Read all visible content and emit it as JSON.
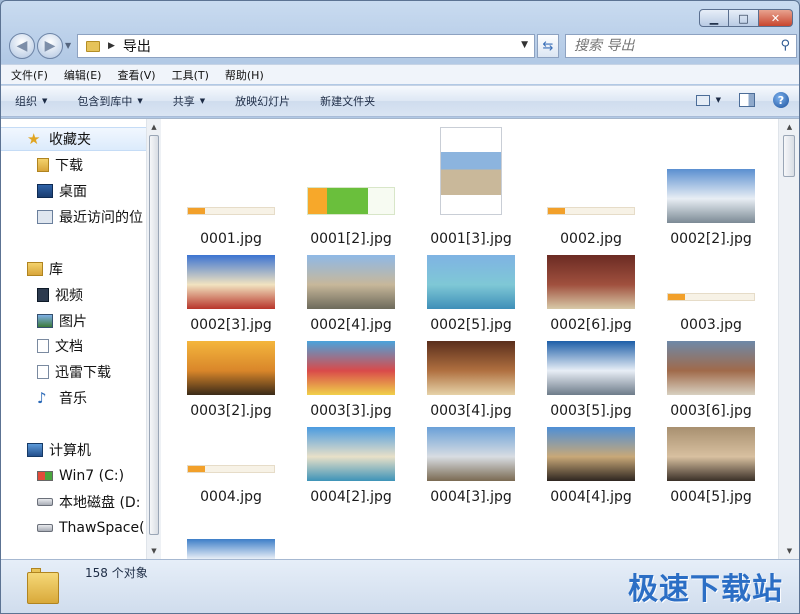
{
  "window": {
    "caption_buttons": {
      "minimize_icon": "minimize-icon",
      "maximize_icon": "maximize-icon",
      "close_icon": "close-icon"
    }
  },
  "address_bar": {
    "path": "导出",
    "search_placeholder": "搜索 导出"
  },
  "menu": [
    "文件(F)",
    "编辑(E)",
    "查看(V)",
    "工具(T)",
    "帮助(H)"
  ],
  "toolbar": {
    "organize": "组织",
    "include_in_library": "包含到库中",
    "share": "共享",
    "slideshow": "放映幻灯片",
    "new_folder": "新建文件夹"
  },
  "navigation": {
    "favorites_header": "收藏夹",
    "favorites": [
      "下载",
      "桌面",
      "最近访问的位"
    ],
    "libraries_header": "库",
    "libraries": [
      "视频",
      "图片",
      "文档",
      "迅雷下载",
      "音乐"
    ],
    "computer_header": "计算机",
    "drives": [
      "Win7 (C:)",
      "本地磁盘 (D:",
      "ThawSpace("
    ]
  },
  "files": [
    {
      "name": "0001.jpg",
      "kind": "banner"
    },
    {
      "name": "0001[2].jpg",
      "kind": "logo"
    },
    {
      "name": "0001[3].jpg",
      "kind": "cover"
    },
    {
      "name": "0002.jpg",
      "kind": "banner"
    },
    {
      "name": "0002[2].jpg",
      "kind": "photo",
      "colors": [
        "#5a8fd0",
        "#e8eef4",
        "#7c8a95"
      ]
    },
    {
      "name": "0002[3].jpg",
      "kind": "photo",
      "colors": [
        "#3c74d2",
        "#f1e3c0",
        "#b8352a"
      ]
    },
    {
      "name": "0002[4].jpg",
      "kind": "photo",
      "colors": [
        "#8fb9e6",
        "#c7b79a",
        "#6d6a5b"
      ]
    },
    {
      "name": "0002[5].jpg",
      "kind": "photo",
      "colors": [
        "#7fb3e3",
        "#7fc8d6",
        "#3e8fb8"
      ]
    },
    {
      "name": "0002[6].jpg",
      "kind": "photo",
      "colors": [
        "#6b2b23",
        "#a0503e",
        "#d8c9a8"
      ]
    },
    {
      "name": "0003.jpg",
      "kind": "banner"
    },
    {
      "name": "0003[2].jpg",
      "kind": "photo",
      "colors": [
        "#f4b63d",
        "#d9862a",
        "#3a2a18"
      ]
    },
    {
      "name": "0003[3].jpg",
      "kind": "photo",
      "colors": [
        "#4aa3dc",
        "#d94a4a",
        "#f0d04a"
      ]
    },
    {
      "name": "0003[4].jpg",
      "kind": "photo",
      "colors": [
        "#5a2e1c",
        "#b07040",
        "#e6d2a8"
      ]
    },
    {
      "name": "0003[5].jpg",
      "kind": "photo",
      "colors": [
        "#1d5ea8",
        "#e8eef6",
        "#6e7c8a"
      ]
    },
    {
      "name": "0003[6].jpg",
      "kind": "photo",
      "colors": [
        "#6e89a8",
        "#a06a4a",
        "#d8d0c0"
      ]
    },
    {
      "name": "0004.jpg",
      "kind": "banner"
    },
    {
      "name": "0004[2].jpg",
      "kind": "photo",
      "colors": [
        "#4a9be0",
        "#e8e0c8",
        "#3d93b8"
      ]
    },
    {
      "name": "0004[3].jpg",
      "kind": "photo",
      "colors": [
        "#6aa0d8",
        "#d8dde2",
        "#7a6a52"
      ]
    },
    {
      "name": "0004[4].jpg",
      "kind": "photo",
      "colors": [
        "#4e8fd6",
        "#c8a878",
        "#2e2620"
      ]
    },
    {
      "name": "0004[5].jpg",
      "kind": "photo",
      "colors": [
        "#a89070",
        "#d8c0a0",
        "#3a3028"
      ]
    },
    {
      "name": "",
      "kind": "partial",
      "colors": [
        "#3d7ec8",
        "#e8eef6",
        "#ffffff"
      ]
    }
  ],
  "status": {
    "item_count": "158 个对象",
    "watermark": "极速下载站"
  }
}
